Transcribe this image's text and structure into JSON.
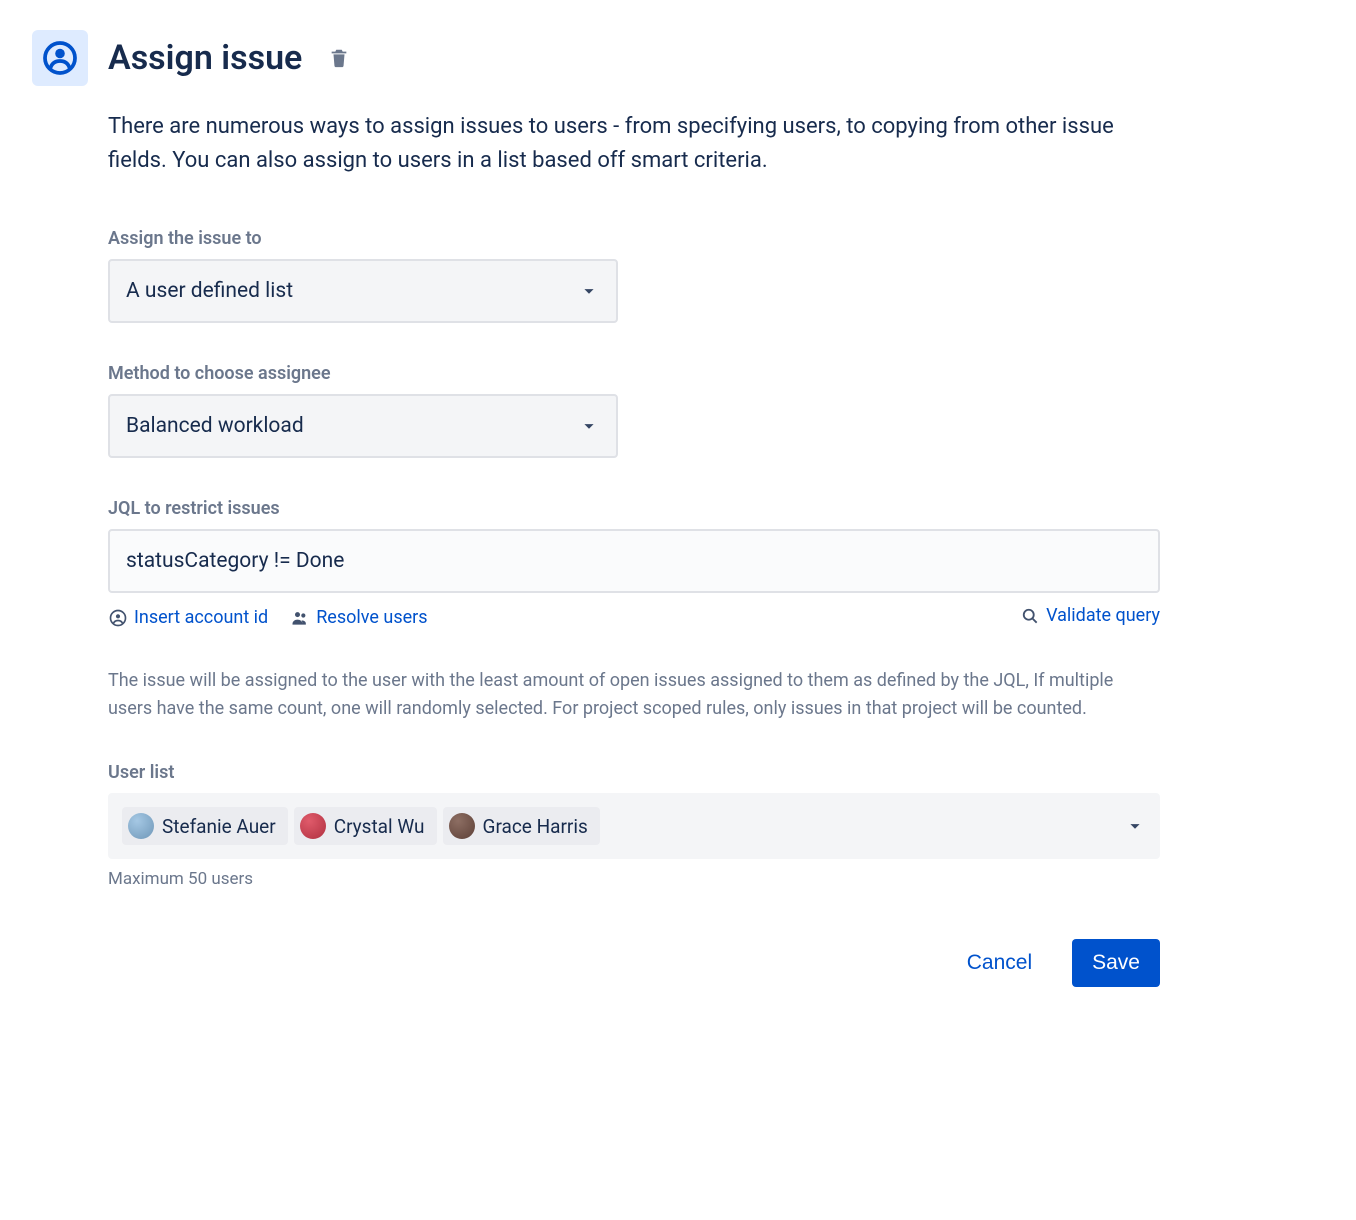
{
  "header": {
    "title": "Assign issue"
  },
  "description": "There are numerous ways to assign issues to users - from specifying users, to copying from other issue fields. You can also assign to users in a list based off smart criteria.",
  "assignTo": {
    "label": "Assign the issue to",
    "value": "A user defined list"
  },
  "method": {
    "label": "Method to choose assignee",
    "value": "Balanced workload"
  },
  "jql": {
    "label": "JQL to restrict issues",
    "value": "statusCategory != Done",
    "links": {
      "insertAccountId": "Insert account id",
      "resolveUsers": "Resolve users",
      "validateQuery": "Validate query"
    }
  },
  "helpText": "The issue will be assigned to the user with the least amount of open issues assigned to them as defined by the JQL, If multiple users have the same count, one will randomly selected. For project scoped rules, only issues in that project will be counted.",
  "userList": {
    "label": "User list",
    "hint": "Maximum 50 users",
    "users": [
      {
        "name": "Stefanie Auer",
        "avatarColor1": "#A5C8E4",
        "avatarColor2": "#6F97B8"
      },
      {
        "name": "Crystal Wu",
        "avatarColor1": "#E05B6B",
        "avatarColor2": "#B03040"
      },
      {
        "name": "Grace Harris",
        "avatarColor1": "#8D6E63",
        "avatarColor2": "#5D4037"
      }
    ]
  },
  "footer": {
    "cancel": "Cancel",
    "save": "Save"
  }
}
